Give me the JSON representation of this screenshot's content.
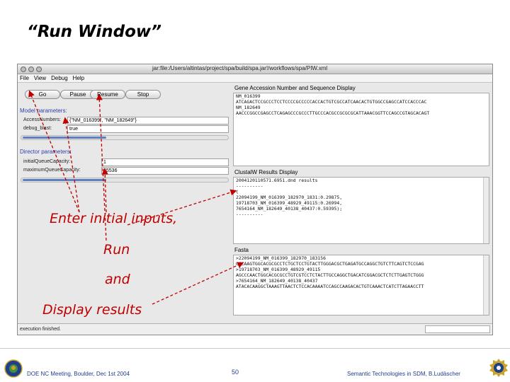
{
  "slide": {
    "title": "“Run Window”"
  },
  "window": {
    "title": "jar:file:/Users/altintas/project/spa/build/spa.jar!/workflows/spa/PIW.xml",
    "menu": [
      "File",
      "View",
      "Debug",
      "Help"
    ],
    "buttons": {
      "go": "Go",
      "pause": "Pause",
      "resume": "Resume",
      "stop": "Stop"
    },
    "model_parameters": {
      "label": "Model parameters:",
      "access_numbers_label": "AccessNumbers:",
      "access_numbers_value": "{\"NM_016399\", \"NM_182649\"}",
      "debug_blast_label": "debug_blast:",
      "debug_blast_value": "true"
    },
    "director_parameters": {
      "label": "Director parameters:",
      "initial_queue_label": "initialQueueCapacity:",
      "initial_queue_value": "1",
      "max_queue_label": "maximumQueueCapacity:",
      "max_queue_value": "65536"
    },
    "panels": {
      "gene": {
        "title": "Gene Accession Number and Sequence Display",
        "lines": [
          "NM_016399",
          "ATCAGACTCCGCCCTCCTCCCCGCCCCCACCACTGTCGCCATCAACACTGTGGCCGAGCCATCCACCCAC",
          "NM_182649",
          "AACCCGGCCGAGCCTCAGAGCCCGCCCTTGCCCACGCCGCGCGCATTAAACGGTTCCAGCCGTAGCACAGT"
        ]
      },
      "clustalw": {
        "title": "ClustalW Results Display",
        "lines": [
          "2004120110571.6951.dnd results",
          "----------",
          "(",
          "22094199_NM_016399_182970_1831:0.29875,",
          "19718703_NM_016399_48929_49115:0.26994,",
          "7654164_NM_182649_40138_40437:0.59395);",
          "----------"
        ]
      },
      "fasta": {
        "title": "Fasta",
        "lines": [
          ">22094199_NM_016399_182970_183156",
          "GCCAAGTGGCACGCGCCTCTGCTCCTGTACTTGGGACGCTGAGATGCCAGGCTGTCTTCAGTCTCCGAG",
          ">19718703_NM_016399_48929_49115",
          "AGCCCAACTGGCACGCGCCTGTCGTCCTCTACTTGCCAGGCTGACATCGGACGCTCTCTTGAGTCTGGG",
          ">7654164_NM_182649_40138_40437",
          "ATACACAAGGCTAAAGTTAACTCTCCACAAAATCCAGCCAAGACACTGTCAAACTCATCTTAGAACCTT"
        ]
      }
    },
    "status": "execution finished."
  },
  "annotations": {
    "line1": "Enter initial inputs,",
    "line2": "Run",
    "line3": "and",
    "line4": "Display results"
  },
  "footer": {
    "left": "DOE NC Meeting, Boulder, Dec 1st 2004",
    "center": "50",
    "right": "Semantic Technologies in SDM, B.Ludäscher"
  },
  "colors": {
    "annotation": "#c00000",
    "section_label": "#2f3fa6",
    "footer_text": "#1f3f8c",
    "scroll_thumb": "#5f7fbf"
  }
}
